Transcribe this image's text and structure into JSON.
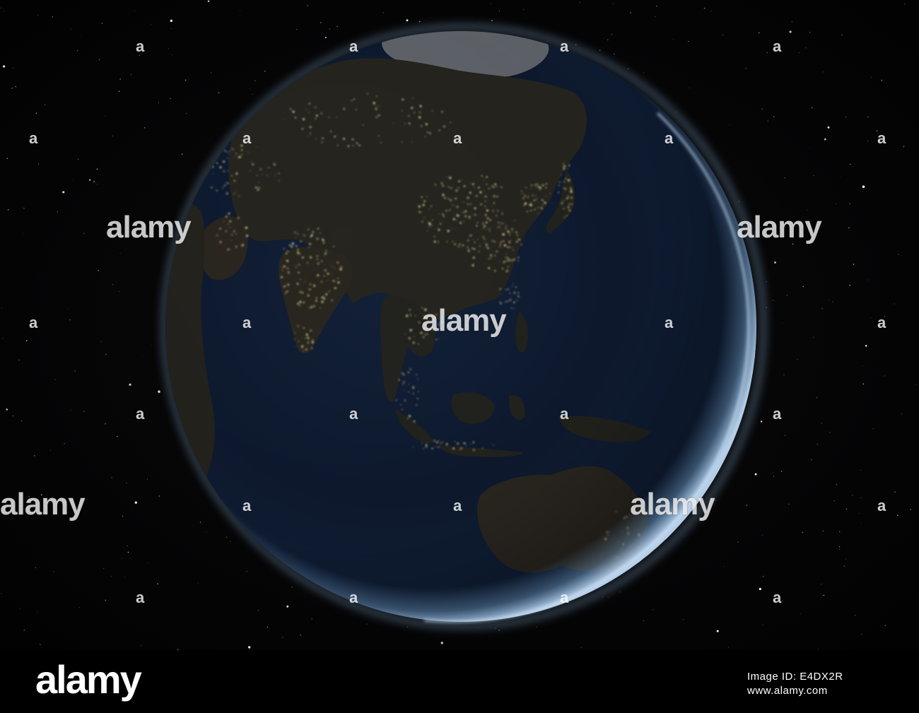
{
  "watermark": {
    "word": "alamy",
    "mark": "a"
  },
  "footer": {
    "brand": "alamy",
    "image_id_line1": "Image ID: E4DX2R",
    "image_id_line2": "www.alamy.com"
  },
  "colors": {
    "space": "#050506",
    "ocean": "#0d1a2e",
    "land": "#2a2a26",
    "city_lights": "#f3e2a0",
    "atmosphere": "#9fc8ea",
    "ice": "#7a7d80"
  }
}
